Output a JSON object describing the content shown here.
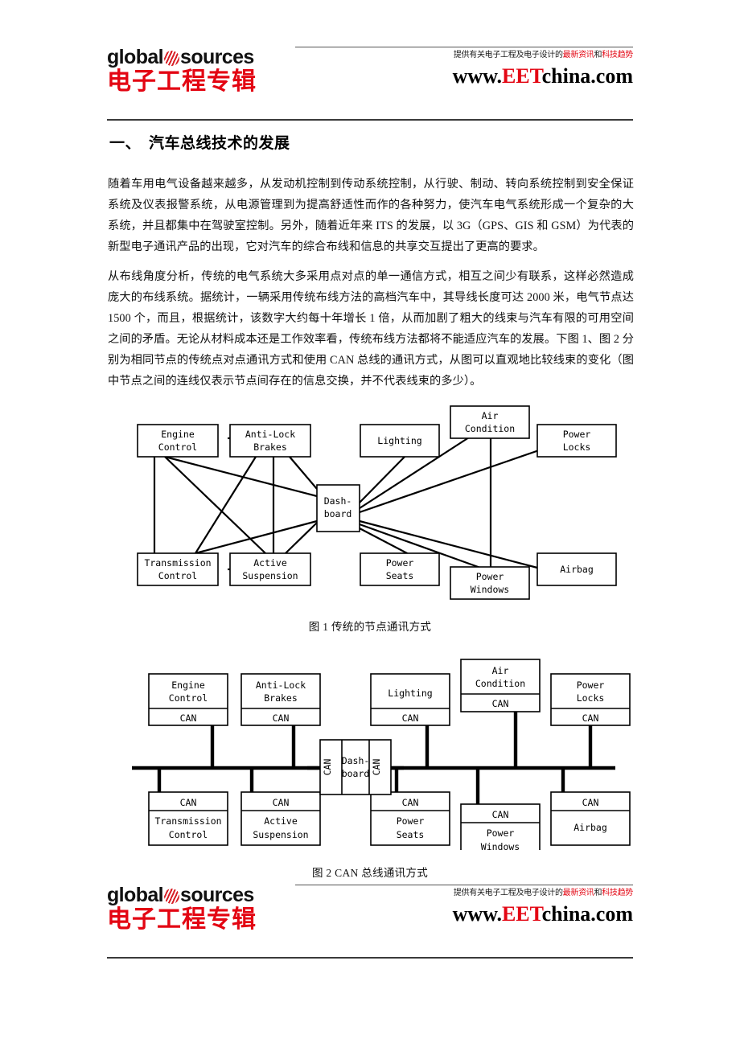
{
  "brand": {
    "logo_word1": "global",
    "logo_word2": "sources",
    "logo_icon": "striped-globe-icon",
    "cn_brand": "电子工程专辑",
    "tagline_prefix": "提供有关电子工程及电子设计的",
    "tagline_red1": "最新资讯",
    "tagline_mid": "和",
    "tagline_red2": "科技趋势",
    "url_prefix": "www.",
    "url_red": "EET",
    "url_suffix": "china.com",
    "accent_red": "#e30613"
  },
  "document": {
    "title": "一、　汽车总线技术的发展",
    "paragraph1": "随着车用电气设备越来越多，从发动机控制到传动系统控制，从行驶、制动、转向系统控制到安全保证系统及仪表报警系统，从电源管理到为提高舒适性而作的各种努力，使汽车电气系统形成一个复杂的大系统，并且都集中在驾驶室控制。另外，随着近年来 ITS 的发展，以 3G（GPS、GIS 和 GSM）为代表的新型电子通讯产品的出现，它对汽车的综合布线和信息的共享交互提出了更高的要求。",
    "paragraph2": "从布线角度分析，传统的电气系统大多采用点对点的单一通信方式，相互之间少有联系，这样必然造成庞大的布线系统。据统计，一辆采用传统布线方法的高档汽车中，其导线长度可达 2000 米，电气节点达 1500 个，而且，根据统计，该数字大约每十年增长 1 倍，从而加剧了粗大的线束与汽车有限的可用空间之间的矛盾。无论从材料成本还是工作效率看，传统布线方法都将不能适应汽车的发展。下图 1、图 2 分别为相同节点的传统点对点通讯方式和使用 CAN 总线的通讯方式，从图可以直观地比较线束的变化（图中节点之间的连线仅表示节点间存在的信息交换，并不代表线束的多少）。"
  },
  "figure1": {
    "caption": "图 1  传统的节点通讯方式",
    "hub_label_line1": "Dash-",
    "hub_label_line2": "board",
    "nodes": [
      {
        "id": "engine",
        "line1": "Engine",
        "line2": "Control"
      },
      {
        "id": "abs",
        "line1": "Anti-Lock",
        "line2": "Brakes"
      },
      {
        "id": "lighting",
        "line1": "Lighting",
        "line2": ""
      },
      {
        "id": "aircondition",
        "line1": "Air",
        "line2": "Condition"
      },
      {
        "id": "powerlocks",
        "line1": "Power",
        "line2": "Locks"
      },
      {
        "id": "transmission",
        "line1": "Transmission",
        "line2": "Control"
      },
      {
        "id": "activesusp",
        "line1": "Active",
        "line2": "Suspension"
      },
      {
        "id": "powerseats",
        "line1": "Power",
        "line2": "Seats"
      },
      {
        "id": "powerwindows",
        "line1": "Power",
        "line2": "Windows"
      },
      {
        "id": "airbag",
        "line1": "Airbag",
        "line2": ""
      }
    ]
  },
  "figure2": {
    "caption": "图 2  CAN 总线通讯方式",
    "can_label": "CAN",
    "hub_label_line1": "Dash-",
    "hub_label_line2": "board",
    "nodes": [
      {
        "id": "engine",
        "line1": "Engine",
        "line2": "Control",
        "can": "CAN"
      },
      {
        "id": "abs",
        "line1": "Anti-Lock",
        "line2": "Brakes",
        "can": "CAN"
      },
      {
        "id": "lighting",
        "line1": "Lighting",
        "line2": "",
        "can": "CAN"
      },
      {
        "id": "aircondition",
        "line1": "Air",
        "line2": "Condition",
        "can": "CAN"
      },
      {
        "id": "powerlocks",
        "line1": "Power",
        "line2": "Locks",
        "can": "CAN"
      },
      {
        "id": "transmission",
        "line1": "Transmission",
        "line2": "Control",
        "can": "CAN"
      },
      {
        "id": "activesusp",
        "line1": "Active",
        "line2": "Suspension",
        "can": "CAN"
      },
      {
        "id": "powerseats",
        "line1": "Power",
        "line2": "Seats",
        "can": "CAN"
      },
      {
        "id": "powerwindows",
        "line1": "Power",
        "line2": "Windows",
        "can": "CAN"
      },
      {
        "id": "airbag",
        "line1": "Airbag",
        "line2": "",
        "can": "CAN"
      }
    ]
  }
}
